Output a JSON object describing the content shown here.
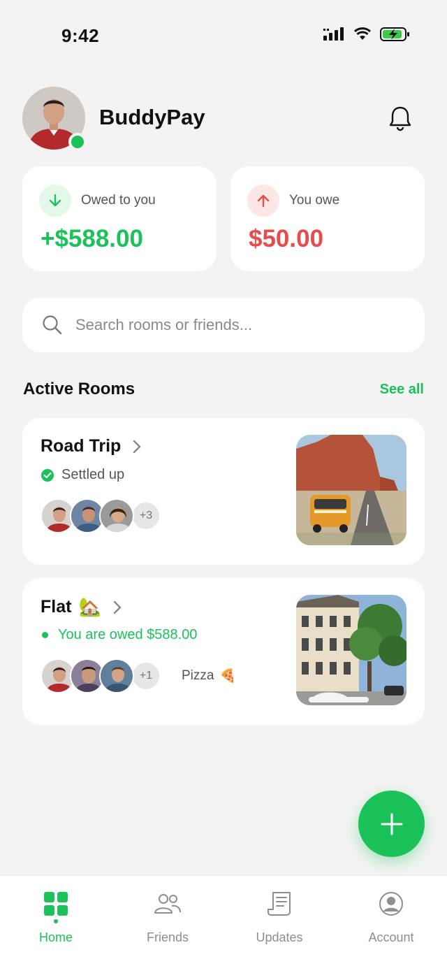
{
  "status_bar": {
    "time": "9:42"
  },
  "header": {
    "app_name": "BuddyPay"
  },
  "balances": {
    "owed_to_you": {
      "label": "Owed to you",
      "amount": "+$588.00",
      "color": "#1bc25a"
    },
    "you_owe": {
      "label": "You owe",
      "amount": "$50.00",
      "color": "#e84b4b"
    }
  },
  "search": {
    "placeholder": "Search rooms or friends..."
  },
  "rooms_section": {
    "title": "Active Rooms",
    "see_all": "See all"
  },
  "rooms": [
    {
      "name": "Road Trip",
      "emoji": "",
      "status": "Settled up",
      "status_type": "settled",
      "extra_members": "+3",
      "tag": "",
      "tag_emoji": ""
    },
    {
      "name": "Flat",
      "emoji": "🏡",
      "status": "You are owed $588.00",
      "status_type": "owed",
      "extra_members": "+1",
      "tag": "Pizza",
      "tag_emoji": "🍕"
    }
  ],
  "tabs": [
    {
      "label": "Home",
      "icon": "grid-icon",
      "active": true
    },
    {
      "label": "Friends",
      "icon": "people-icon",
      "active": false
    },
    {
      "label": "Updates",
      "icon": "receipt-icon",
      "active": false
    },
    {
      "label": "Account",
      "icon": "user-circle-icon",
      "active": false
    }
  ],
  "colors": {
    "accent": "#1bc25a",
    "negative": "#e84b4b",
    "background": "#f3f3f3"
  }
}
